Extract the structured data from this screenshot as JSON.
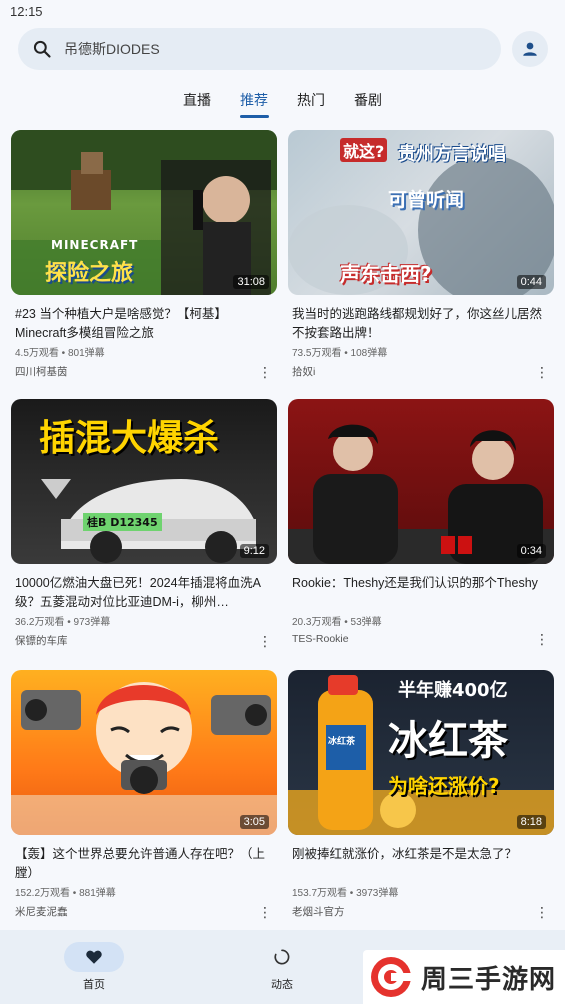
{
  "status_bar": {
    "time": "12:15"
  },
  "search": {
    "text": "吊德斯DIODES"
  },
  "tabs": [
    {
      "label": "直播"
    },
    {
      "label": "推荐"
    },
    {
      "label": "热门"
    },
    {
      "label": "番剧"
    }
  ],
  "videos": [
    {
      "title": "#23  当个种植大户是啥感觉？【柯基】Minecraft多模组冒险之旅",
      "stats": "4.5万观看 • 801弹幕",
      "author": "四川柯基茵",
      "duration": "31:08",
      "thumb_text": [
        "MINECRAFT",
        "探险之旅"
      ]
    },
    {
      "title": "我当时的逃跑路线都规划好了，你这丝儿居然不按套路出牌！",
      "stats": "73.5万观看 • 108弹幕",
      "author": "拾奴i",
      "duration": "0:44",
      "thumb_text": [
        "就这?",
        "贵州方言说唱",
        "可曾听闻",
        "声东击西?"
      ]
    },
    {
      "title": "10000亿燃油大盘已死！2024年插混将血洗A级？五菱混动对位比亚迪DM-i，柳州…",
      "stats": "36.2万观看 • 973弹幕",
      "author": "保镖的车库",
      "duration": "9:12",
      "thumb_text": [
        "插混大爆杀",
        "桂B D12345"
      ]
    },
    {
      "title": "Rookie：Theshy还是我们认识的那个Theshy",
      "stats": "20.3万观看 • 53弹幕",
      "author": "TES-Rookie",
      "duration": "0:34",
      "thumb_text": []
    },
    {
      "title": "【轰】这个世界总要允许普通人存在吧？（上膛）",
      "stats": "152.2万观看 • 881弹幕",
      "author": "米尼麦泥蠢",
      "duration": "3:05",
      "thumb_text": []
    },
    {
      "title": "刚被捧红就涨价，冰红茶是不是太急了？",
      "stats": "153.7万观看 • 3973弹幕",
      "author": "老烟斗官方",
      "duration": "8:18",
      "thumb_text": [
        "半年赚400亿",
        "冰红茶",
        "为啥还涨价?",
        "冰红茶"
      ]
    }
  ],
  "bottom_nav": [
    {
      "label": "首页"
    },
    {
      "label": "动态"
    },
    {
      "label": ""
    }
  ],
  "watermark": {
    "text": "周三手游网"
  },
  "colors": {
    "accent": "#1e5ea8",
    "background": "#f6f8fc",
    "search_bg": "#e5ecf4"
  }
}
